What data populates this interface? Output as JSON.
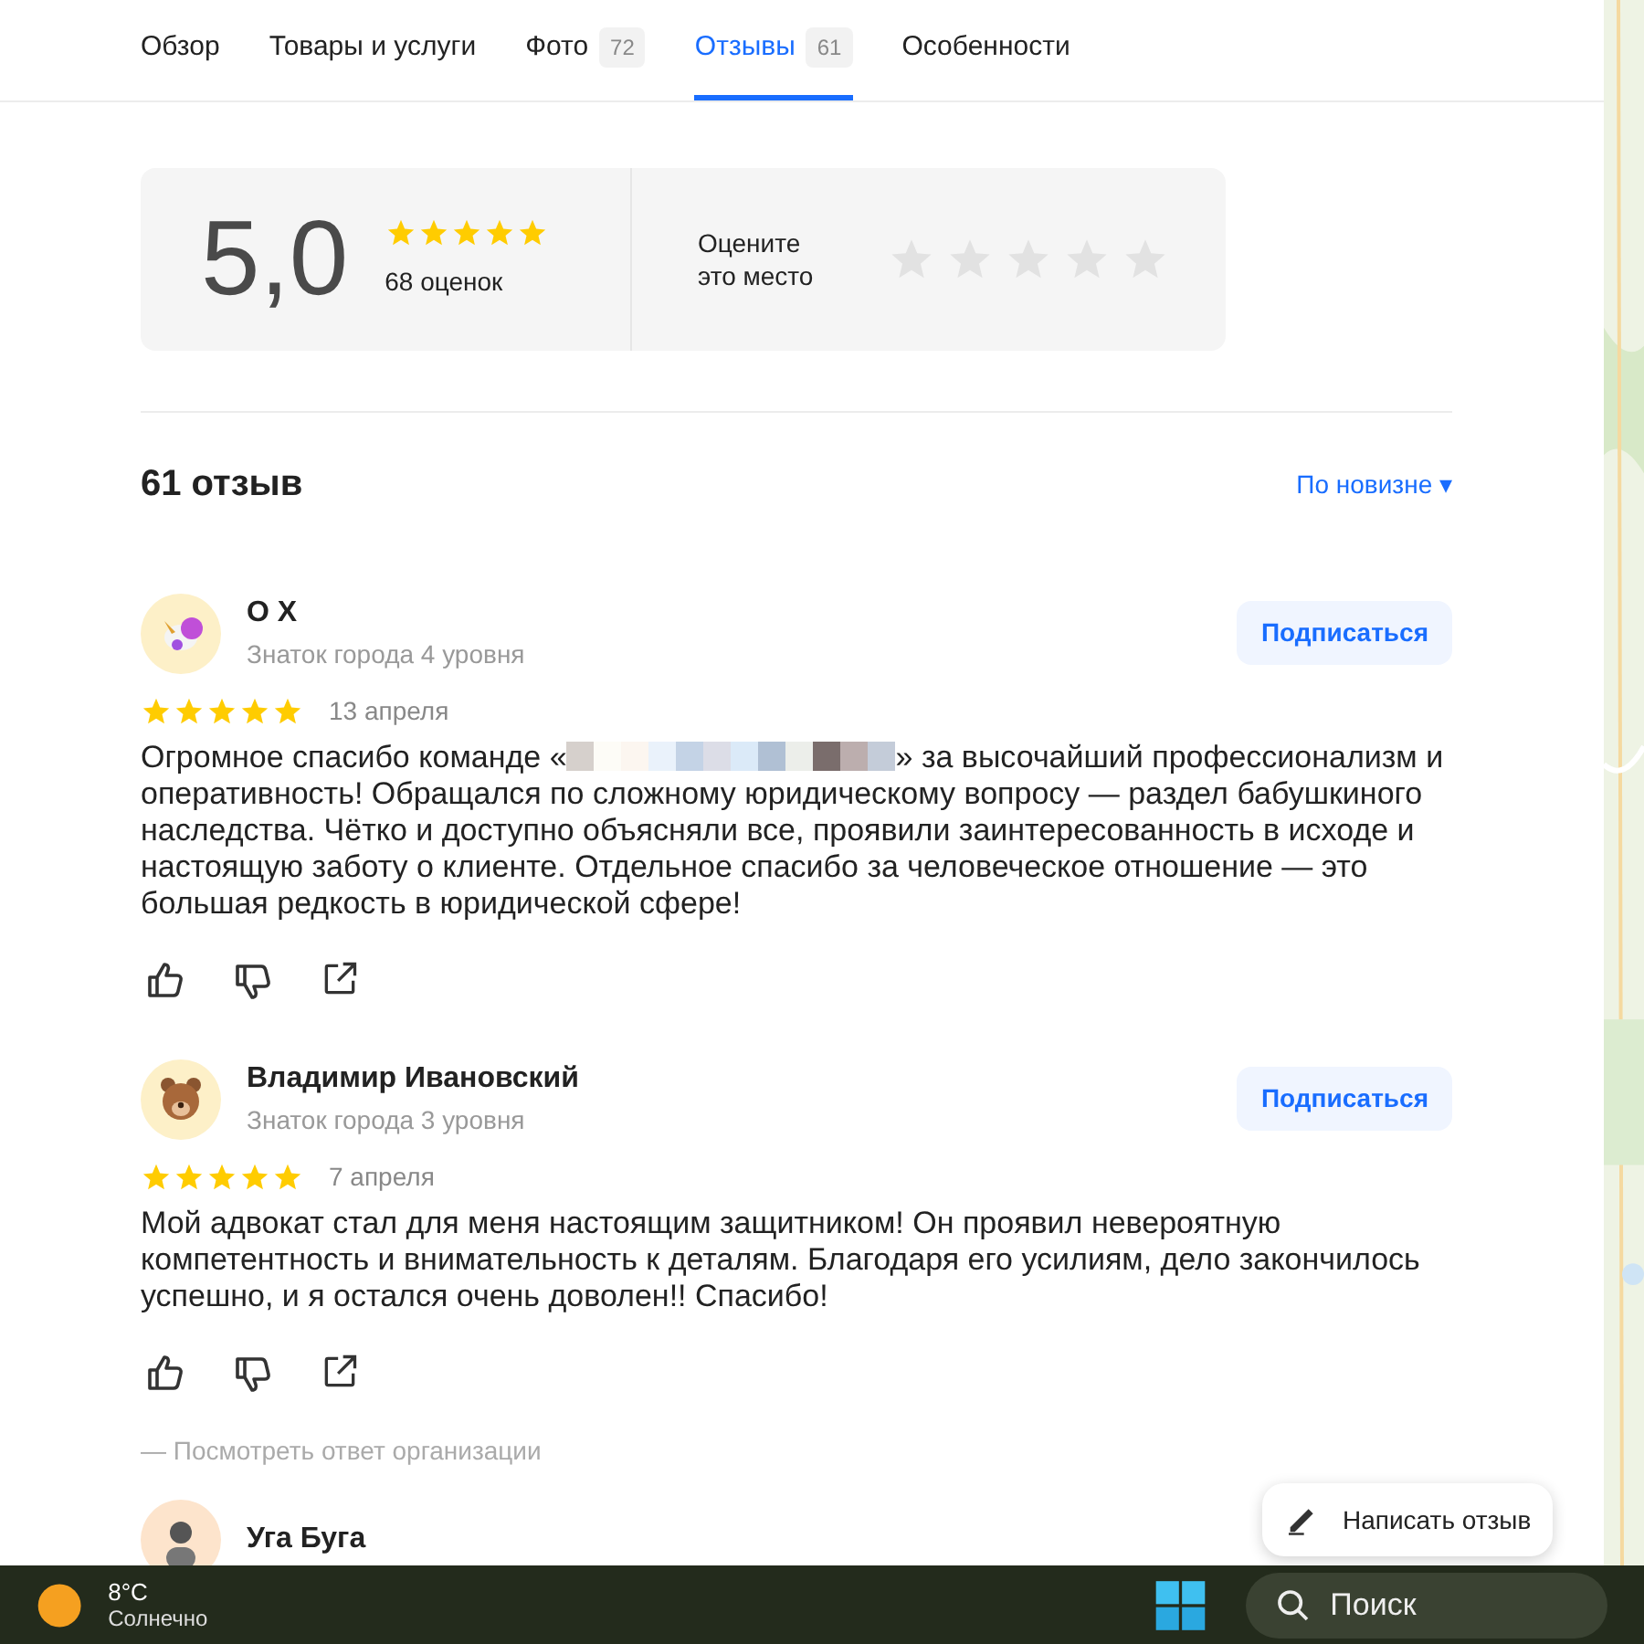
{
  "tabs": [
    {
      "label": "Обзор",
      "selected": false
    },
    {
      "label": "Товары и услуги",
      "selected": false
    },
    {
      "label": "Фото",
      "count": "72",
      "selected": false
    },
    {
      "label": "Отзывы",
      "count": "61",
      "selected": true
    },
    {
      "label": "Особенности",
      "selected": false
    }
  ],
  "rating": {
    "score": "5,0",
    "stars": 5,
    "count": "68 оценок",
    "prompt": "Оцените это место"
  },
  "reviews_header": {
    "title": "61 отзыв",
    "sort": "По новизне ▾"
  },
  "reviews": [
    {
      "kind": "unicorn",
      "name": "O X",
      "level": "Знаток города 4 уровня",
      "subscribe": "Подписаться",
      "stars": 5,
      "date": "13 апреля",
      "text_before": "Огромное спасибо команде «",
      "redacted": true,
      "text_after": "» за высочайший профессионализм и оперативность! Обращался по сложному юридическому вопросу — раздел бабушкиного наследства. Чётко и доступно объясняли все, проявили заинтересованность в исходе и настоящую заботу о клиенте. Отдельное спасибо за человеческое отношение — это большая редкость в юридической сфере!"
    },
    {
      "kind": "bear",
      "name": "Владимир Ивановский",
      "level": "Знаток города 3 уровня",
      "subscribe": "Подписаться",
      "stars": 5,
      "date": "7 апреля",
      "text_before": "Мой адвокат стал для меня настоящим защитником! Он проявил невероятную компетентность и внимательность к деталям. Благодаря его усилиям, дело закончилось успешно, и я остался очень доволен!! Спасибо!",
      "redacted": false,
      "org_reply": "— Посмотреть ответ организации"
    },
    {
      "kind": "person",
      "name": "Уга Буга"
    }
  ],
  "write_review": "Написать отзыв",
  "taskbar": {
    "temp": "8°C",
    "weather": "Солнечно",
    "search": "Поиск"
  }
}
